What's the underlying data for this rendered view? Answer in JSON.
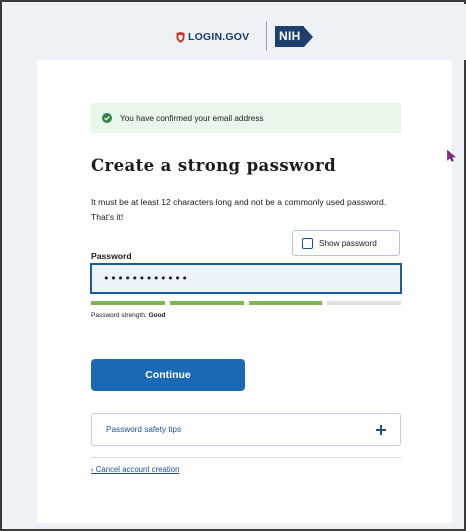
{
  "header": {
    "login_logo_text": "LOGIN.GOV",
    "agency_logo_text": "NIH"
  },
  "alert": {
    "message": "You have confirmed your email address"
  },
  "form": {
    "title": "Create a strong password",
    "description": "It must be at least 12 characters long and not be a commonly used password. That's it!",
    "show_password_label": "Show password",
    "password_label": "Password",
    "password_value": "••••••••••••",
    "strength_prefix": "Password strength:",
    "strength_value": "Good",
    "strength_level": 0.75,
    "continue_label": "Continue"
  },
  "tips": {
    "accordion_label": "Password safety tips"
  },
  "footer": {
    "cancel_link": "‹ Cancel account creation"
  },
  "colors": {
    "brand_blue": "#1b68b3",
    "strength_filled": "#7fb84a",
    "strength_empty": "#dfe1e2",
    "alert_bg": "#e9f6ea",
    "shield_red": "#d12f2f",
    "nih_blue": "#1e3f6e"
  }
}
